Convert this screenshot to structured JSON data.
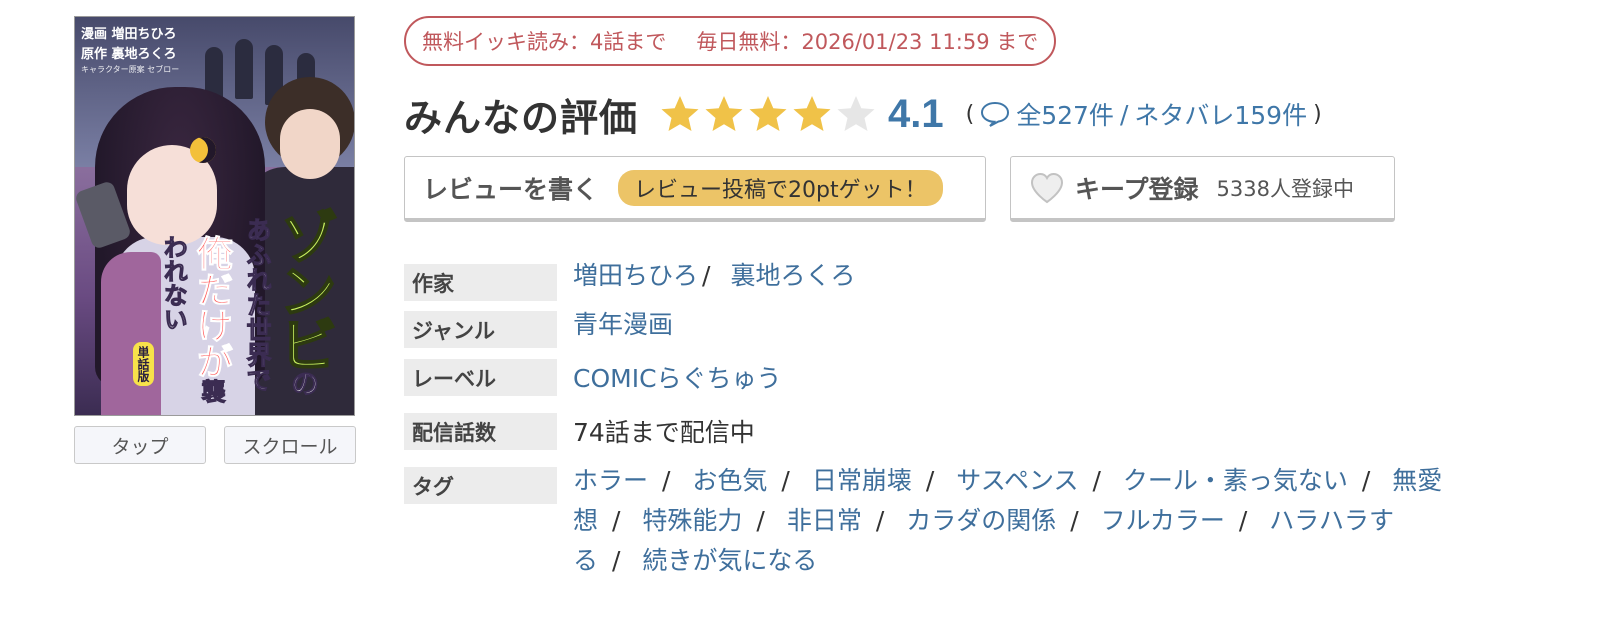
{
  "cover": {
    "credits": [
      "漫画 増田ちひろ",
      "原作 裏地ろくろ",
      "キャラクター原案 セブロー"
    ],
    "title_main": "ゾンビ",
    "title_particle": "の",
    "title_sub": "あふれた世界で",
    "title_emph": "俺だけが",
    "title_tail": "襲われない",
    "edition_badge": "単話版"
  },
  "cover_buttons": {
    "tap": "タップ",
    "scroll": "スクロール"
  },
  "free_badge": {
    "binge": "無料イッキ読み：4話まで",
    "daily": "毎日無料：2026/01/23 11:59 まで"
  },
  "rating": {
    "title": "みんなの評価",
    "score": "4.1",
    "stars_filled": 4,
    "stars_total": 5,
    "open_paren": "(",
    "close_paren": ")",
    "total_reviews": "全527件",
    "separator": "/",
    "spoiler_reviews": "ネタバレ159件"
  },
  "actions": {
    "write_review": "レビューを書く",
    "review_bonus": "レビュー投稿で20ptゲット！",
    "keep": "キープ登録",
    "keep_count": "5338人登録中"
  },
  "info": {
    "author_label": "作家",
    "authors": [
      "増田ちひろ",
      "裏地ろくろ"
    ],
    "author_separator": "/",
    "genre_label": "ジャンル",
    "genre": "青年漫画",
    "label_label": "レーベル",
    "label": "COMICらぐちゅう",
    "episodes_label": "配信話数",
    "episodes": "74話まで配信中",
    "tags_label": "タグ",
    "tag_separator": "/",
    "tags": [
      "ホラー",
      "お色気",
      "日常崩壊",
      "サスペンス",
      "クール・素っ気ない",
      "無愛想",
      "特殊能力",
      "非日常",
      "カラダの関係",
      "フルカラー",
      "ハラハラする",
      "続きが気になる"
    ]
  },
  "colors": {
    "link": "#3f77a8",
    "free_badge": "#c0585c",
    "star_on": "#f0c248",
    "star_off": "#e6e6e6",
    "bonus_pill": "#ecc467"
  }
}
